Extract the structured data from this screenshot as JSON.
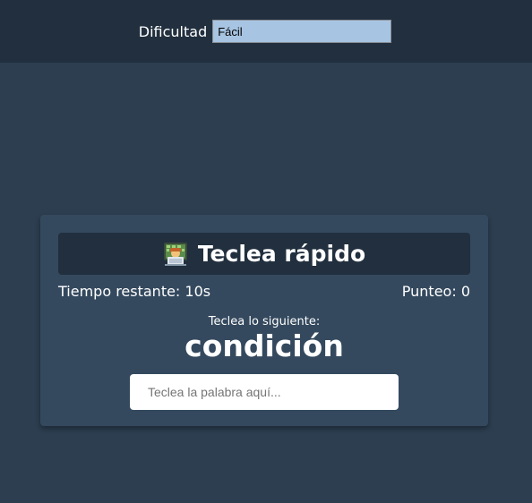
{
  "settings": {
    "difficulty_label": "Dificultad",
    "difficulty_value": "Fácil"
  },
  "game": {
    "title": "Teclea rápido",
    "title_icon": "person-at-computer-icon",
    "time_label": "Tiempo restante:",
    "time_value": "10s",
    "score_label": "Punteo:",
    "score_value": "0",
    "prompt": "Teclea lo siguiente:",
    "word": "condición",
    "input_placeholder": "Teclea la palabra aquí..."
  },
  "colors": {
    "page_bg": "#2c3e50",
    "header_bg": "#212f3e",
    "card_bg": "#34495e",
    "select_bg": "#a7c4e2"
  }
}
